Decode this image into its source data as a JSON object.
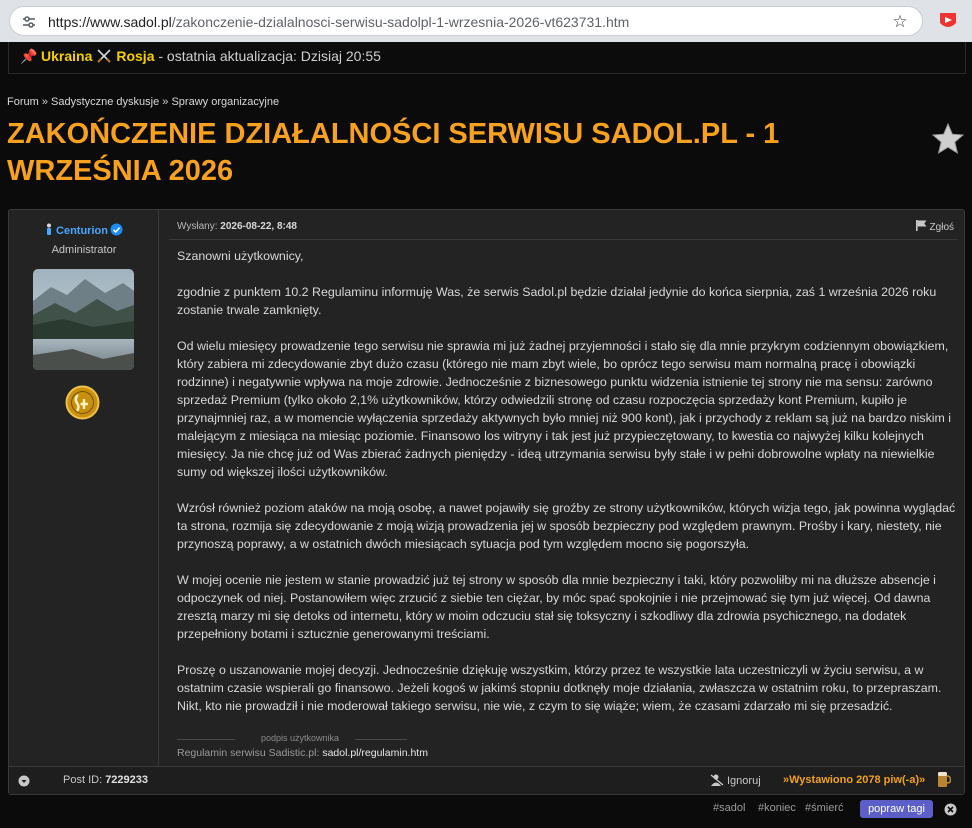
{
  "browser": {
    "url_host": "https://www.sadol.pl",
    "url_path": "/zakonczenie-dzialalnosci-serwisu-sadolpl-1-wrzesnia-2026-vt623731.htm"
  },
  "news": {
    "ukraina": "Ukraina",
    "rosja": "Rosja",
    "rest": " - ostatnia aktualizacja: Dzisiaj 20:55"
  },
  "breadcrumb": {
    "forum": "Forum",
    "sep": " » ",
    "section": "Sadystyczne dyskusje",
    "sub": "Sprawy organizacyjne"
  },
  "title": "ZAKOŃCZENIE DZIAŁALNOŚCI SERWISU SADOL.PL - 1 WRZEŚNIA 2026",
  "post": {
    "author": "Centurion",
    "role": "Administrator",
    "meta_prefix": "Wysłany: ",
    "date": "2026-08-22, 8:48",
    "report": "Zgłoś",
    "paragraphs": [
      "Szanowni użytkownicy,",
      "zgodnie z punktem 10.2 Regulaminu informuję Was, że serwis Sadol.pl będzie działał jedynie do końca sierpnia, zaś 1 września 2026 roku zostanie trwale zamknięty.",
      "Od wielu miesięcy prowadzenie tego serwisu nie sprawia mi już żadnej przyjemności i stało się dla mnie przykrym codziennym obowiązkiem, który zabiera mi zdecydowanie zbyt dużo czasu (którego nie mam zbyt wiele, bo oprócz tego serwisu mam normalną pracę i obowiązki rodzinne) i negatywnie wpływa na moje zdrowie. Jednocześnie z biznesowego punktu widzenia istnienie tej strony nie ma sensu: zarówno sprzedaż Premium (tylko około 2,1% użytkowników, którzy odwiedzili stronę od czasu rozpoczęcia sprzedaży kont Premium, kupiło je przynajmniej raz, a w momencie wyłączenia sprzedaży aktywnych było mniej niż 900 kont), jak i przychody z reklam są już na bardzo niskim i malejącym z miesiąca na miesiąc poziomie. Finansowo los witryny i tak jest już przypieczętowany, to kwestia co najwyżej kilku kolejnych miesięcy. Ja nie chcę już od Was zbierać żadnych pieniędzy - ideą utrzymania serwisu były stałe i w pełni dobrowolne wpłaty na niewielkie sumy od większej ilości użytkowników.",
      "Wzrósł również poziom ataków na moją osobę, a nawet pojawiły się groźby ze strony użytkowników, których wizja tego, jak powinna wyglądać ta strona, rozmija się zdecydowanie z moją wizją prowadzenia jej w sposób bezpieczny pod względem prawnym. Prośby i kary, niestety, nie przynoszą poprawy, a w ostatnich dwóch miesiącach sytuacja pod tym względem mocno się pogorszyła.",
      "W mojej ocenie nie jestem w stanie prowadzić już tej strony w sposób dla mnie bezpieczny i taki, który pozwoliłby mi na dłuższe absencje i odpoczynek od niej. Postanowiłem więc zrzucić z siebie ten ciężar, by móc spać spokojnie i nie przejmować się tym już więcej. Od dawna zresztą marzy mi się detoks od internetu, który w moim odczuciu stał się toksyczny i szkodliwy dla zdrowia psychicznego, na dodatek przepełniony botami i sztucznie generowanymi treściami.",
      "Proszę o uszanowanie mojej decyzji. Jednocześnie dziękuję wszystkim, którzy przez te wszystkie lata uczestniczyli w życiu serwisu, a w ostatnim czasie wspierali go finansowo. Jeżeli kogoś w jakimś stopniu dotknęły moje działania, zwłaszcza w ostatnim roku, to przepraszam. Nikt, kto nie prowadził i nie moderował takiego serwisu, nie wie, z czym to się wiąże; wiem, że czasami zdarzało mi się przesadzić."
    ],
    "signature_label": "podpis użytkownika",
    "signature_text": "Regulamin serwisu Sadistic.pl: ",
    "signature_link": "sadol.pl/regulamin.htm"
  },
  "footer": {
    "post_id_label": "Post ID: ",
    "post_id": "7229233",
    "ignore": "Ignoruj",
    "beers": "Wystawiono 2078 piw(-a)"
  },
  "tags": {
    "items": [
      "#sadol",
      "#koniec",
      "#śmierć"
    ],
    "edit_button": "popraw tagi"
  },
  "colors": {
    "title": "#f8a11e",
    "author": "#4aa7ff",
    "news_highlight": "#f5d000",
    "tag_button": "#5b5fc7"
  },
  "icons": [
    "tune-icon",
    "bookmark-star-icon",
    "extension-icon",
    "pin-icon",
    "crossed-swords-icon",
    "favorite-star-icon",
    "user-icon",
    "verified-icon",
    "badge-icon",
    "flag-icon",
    "arrow-down-icon",
    "ignore-icon",
    "beer-icon",
    "close-icon"
  ]
}
